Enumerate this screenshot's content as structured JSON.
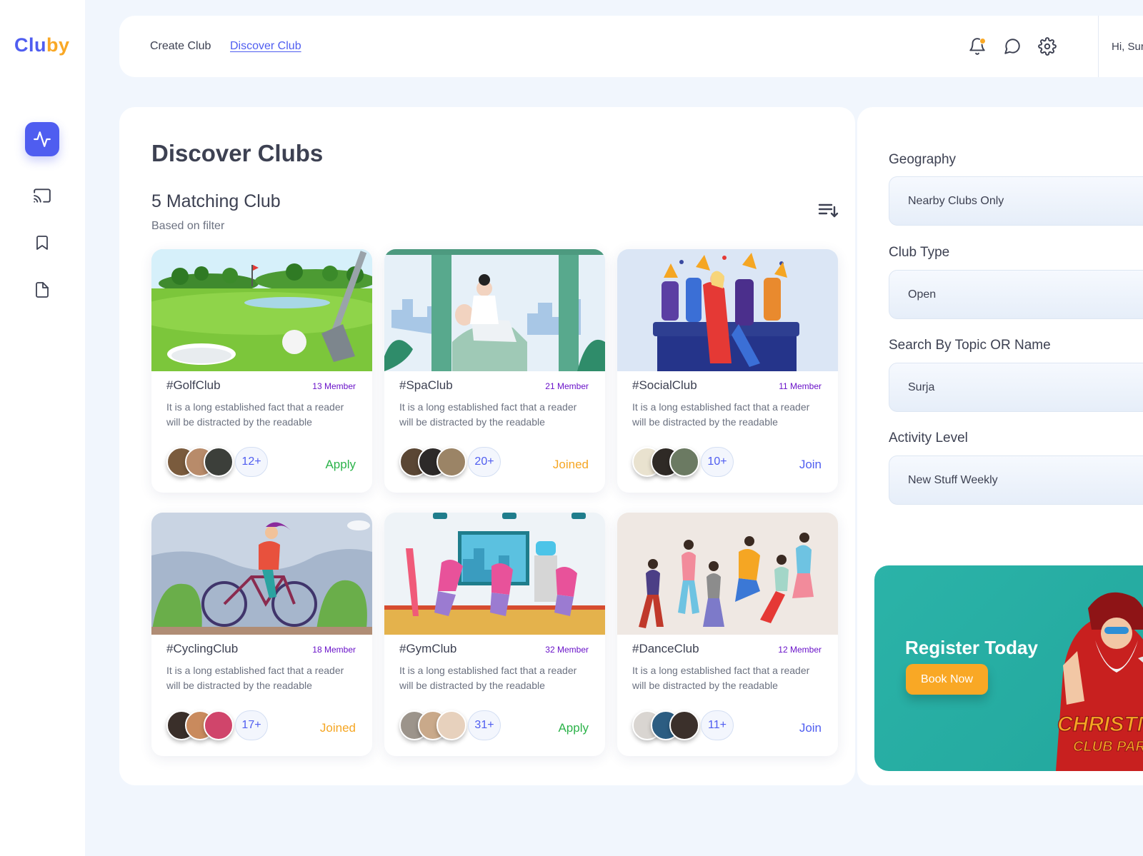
{
  "brand": {
    "part1": "Clu",
    "part2": "by"
  },
  "topbar": {
    "create_label": "Create Club",
    "discover_label": "Discover Club",
    "greeting": "Hi, Sur"
  },
  "main": {
    "title": "Discover Clubs",
    "match_count": "5 Matching Club",
    "match_sub": "Based on filter"
  },
  "clubs": [
    {
      "name": "#GolfClub",
      "members": "13 Member",
      "desc": "It is a long established fact that a reader will be distracted by the readable",
      "more": "12+",
      "action": "Apply",
      "action_type": "apply",
      "image": "golf-illustration"
    },
    {
      "name": "#SpaClub",
      "members": "21 Member",
      "desc": "It is a long established fact that a reader will be distracted by the readable",
      "more": "20+",
      "action": "Joined",
      "action_type": "joined",
      "image": "spa-illustration"
    },
    {
      "name": "#SocialClub",
      "members": "11 Member",
      "desc": "It is a long established fact that a reader will be distracted by the readable",
      "more": "10+",
      "action": "Join",
      "action_type": "join",
      "image": "party-illustration"
    },
    {
      "name": "#CyclingClub",
      "members": "18 Member",
      "desc": "It is a long established fact that a reader will be distracted by the readable",
      "more": "17+",
      "action": "Joined",
      "action_type": "joined",
      "image": "cycling-illustration"
    },
    {
      "name": "#GymClub",
      "members": "32 Member",
      "desc": "It is a long established fact that a reader will be distracted by the readable",
      "more": "31+",
      "action": "Apply",
      "action_type": "apply",
      "image": "gym-illustration"
    },
    {
      "name": "#DanceClub",
      "members": "12 Member",
      "desc": "It is a long established fact that a reader will be distracted by the readable",
      "more": "11+",
      "action": "Join",
      "action_type": "join",
      "image": "dance-illustration"
    }
  ],
  "filters": {
    "geography_label": "Geography",
    "geography_value": "Nearby Clubs Only",
    "club_type_label": "Club Type",
    "club_type_value": "Open",
    "search_label": "Search By Topic OR Name",
    "search_value": "Surja",
    "activity_label": "Activity Level",
    "activity_value": "New Stuff Weekly"
  },
  "promo": {
    "title": "Register Today",
    "button": "Book Now",
    "art_text_1": "CHRISTMA",
    "art_text_2": "CLUB PARTY"
  },
  "icons": {
    "sidebar": [
      "activity-icon",
      "cast-icon",
      "bookmark-icon",
      "file-icon"
    ],
    "topbar": [
      "bell-icon",
      "chat-icon",
      "gear-icon"
    ]
  },
  "colors": {
    "accent": "#4f5df0",
    "brand_orange": "#f9a825",
    "apply": "#2cb34a",
    "joined": "#f5a623",
    "member_purple": "#6a13c9",
    "promo_teal": "#22a79d"
  }
}
